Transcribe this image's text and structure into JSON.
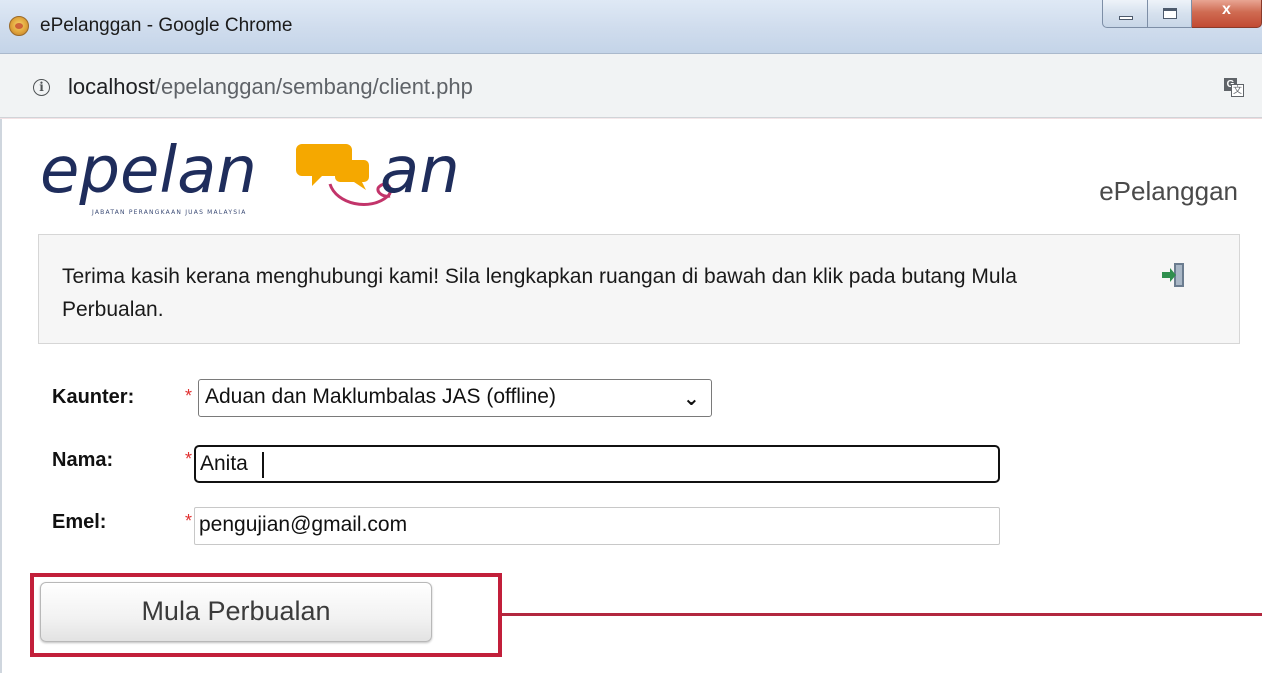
{
  "window": {
    "title": "ePelanggan - Google Chrome",
    "controls": {
      "close_glyph": "x"
    }
  },
  "address_bar": {
    "host": "localhost",
    "path": "/epelanggan/sembang/client.php"
  },
  "header": {
    "logo_text": "epelan   an",
    "logo_tagline": "JABATAN PERANGKAAN JUAS MALAYSIA",
    "brand_label": "ePelanggan"
  },
  "notice": {
    "text": "Terima kasih kerana menghubungi kami! Sila lengkapkan ruangan di bawah dan klik pada butang Mula Perbualan."
  },
  "form": {
    "counter_label": "Kaunter:",
    "counter_value": "Aduan dan Maklumbalas JAS (offline)",
    "name_label": "Nama:",
    "name_value": "Anita",
    "email_label": "Emel:",
    "email_value": "pengujian@gmail.com",
    "required_mark": "*",
    "submit_label": "Mula Perbualan"
  },
  "colors": {
    "highlight": "#c21f3a",
    "logo_navy": "#1f2d5c",
    "logo_accent": "#f5a800"
  },
  "icons": {
    "window": "app-seal-icon",
    "info": "info-icon",
    "translate": "translate-icon",
    "logout": "logout-icon"
  }
}
